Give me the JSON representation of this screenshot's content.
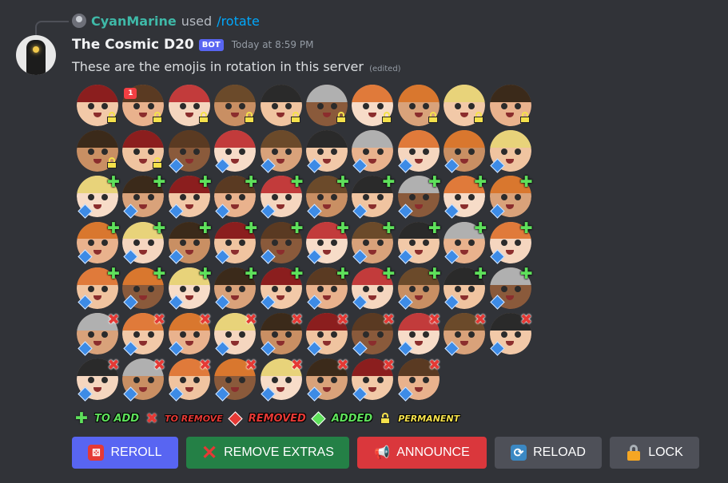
{
  "reply": {
    "user": "CyanMarine",
    "used": "used",
    "command": "/rotate"
  },
  "header": {
    "name": "The Cosmic D20",
    "bot_tag": "BOT",
    "timestamp": "Today at 8:59 PM"
  },
  "message": {
    "text": "These are the emojis in rotation in this server",
    "edited": "(edited)"
  },
  "colors": {
    "background": "#313338",
    "reply_user": "#3fb9a8",
    "command_link": "#00a8fc",
    "bot_tag": "#5865f2",
    "add_marker": "#5ee05b",
    "remove_marker": "#e53935",
    "permanent_marker": "#f5e14b",
    "current_marker": "#3d8be6"
  },
  "emoji_rows": [
    {
      "marker": "permanent",
      "count": 10,
      "badge_on": 1,
      "badge_text": "1"
    },
    {
      "marker": "mixed_row2",
      "count": 10
    },
    {
      "marker": "mixed_row3",
      "count": 10
    },
    {
      "marker": "to_add",
      "count": 10
    },
    {
      "marker": "to_add",
      "count": 10
    },
    {
      "marker": "to_remove",
      "count": 10
    },
    {
      "marker": "to_remove",
      "count": 8
    }
  ],
  "legend": {
    "to_add": "TO ADD",
    "to_remove": "TO REMOVE",
    "removed": "REMOVED",
    "added": "ADDED",
    "permanent": "PERMANENT",
    "icons": [
      "plus-icon",
      "x-icon",
      "removed-diamond-icon",
      "added-diamond-icon",
      "lock-icon"
    ]
  },
  "buttons": {
    "reroll": {
      "label": "REROLL",
      "icon": "die-icon"
    },
    "remove_extras": {
      "label": "REMOVE EXTRAS",
      "icon": "cross-icon"
    },
    "announce": {
      "label": "ANNOUNCE",
      "icon": "megaphone-icon"
    },
    "reload": {
      "label": "RELOAD",
      "icon": "cycle-icon"
    },
    "lock": {
      "label": "LOCK",
      "icon": "padlock-icon"
    }
  }
}
